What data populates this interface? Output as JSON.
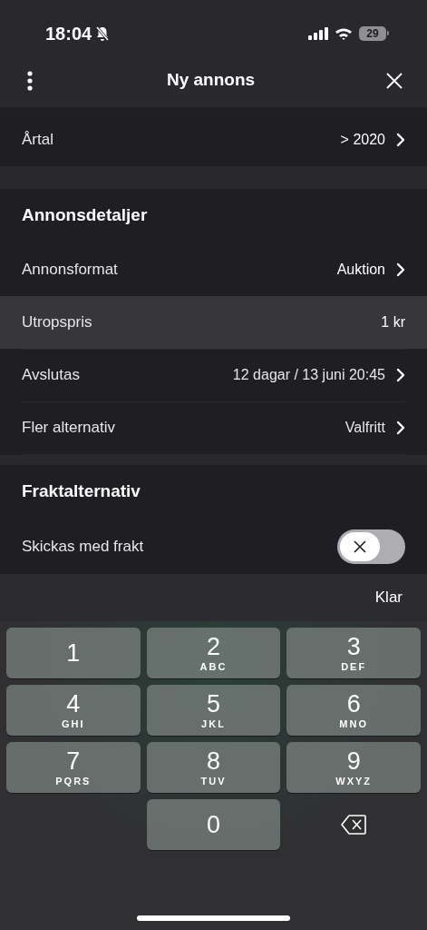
{
  "status_bar": {
    "time": "18:04",
    "battery": "29"
  },
  "header": {
    "title": "Ny annons"
  },
  "sections": [
    {
      "rows": [
        {
          "kind": "nav",
          "label": "Årtal",
          "value": "> 2020",
          "selected": false
        }
      ]
    },
    {
      "heading": "Annonsdetaljer",
      "rows": [
        {
          "kind": "nav",
          "label": "Annonsformat",
          "value": "Auktion",
          "selected": false
        },
        {
          "kind": "input",
          "label": "Utropspris",
          "value": "1 kr",
          "selected": true
        },
        {
          "kind": "nav",
          "label": "Avslutas",
          "value": "12 dagar / 13 juni 20:45",
          "selected": false
        },
        {
          "kind": "nav",
          "label": "Fler alternativ",
          "value": "Valfritt",
          "selected": false
        }
      ]
    },
    {
      "heading": "Fraktalternativ",
      "rows": [
        {
          "kind": "toggle",
          "label": "Skickas med frakt",
          "on": false,
          "selected": false
        }
      ]
    }
  ],
  "keyboard_toolbar": {
    "done": "Klar"
  },
  "keys": [
    {
      "kind": "digit",
      "digit": "1"
    },
    {
      "kind": "digit",
      "digit": "2",
      "letters": "ABC"
    },
    {
      "kind": "digit",
      "digit": "3",
      "letters": "DEF"
    },
    {
      "kind": "digit",
      "digit": "4",
      "letters": "GHI"
    },
    {
      "kind": "digit",
      "digit": "5",
      "letters": "JKL"
    },
    {
      "kind": "digit",
      "digit": "6",
      "letters": "MNO"
    },
    {
      "kind": "digit",
      "digit": "7",
      "letters": "PQRS"
    },
    {
      "kind": "digit",
      "digit": "8",
      "letters": "TUV"
    },
    {
      "kind": "digit",
      "digit": "9",
      "letters": "WXYZ"
    },
    {
      "kind": "blank"
    },
    {
      "kind": "digit",
      "digit": "0"
    },
    {
      "kind": "delete"
    }
  ]
}
